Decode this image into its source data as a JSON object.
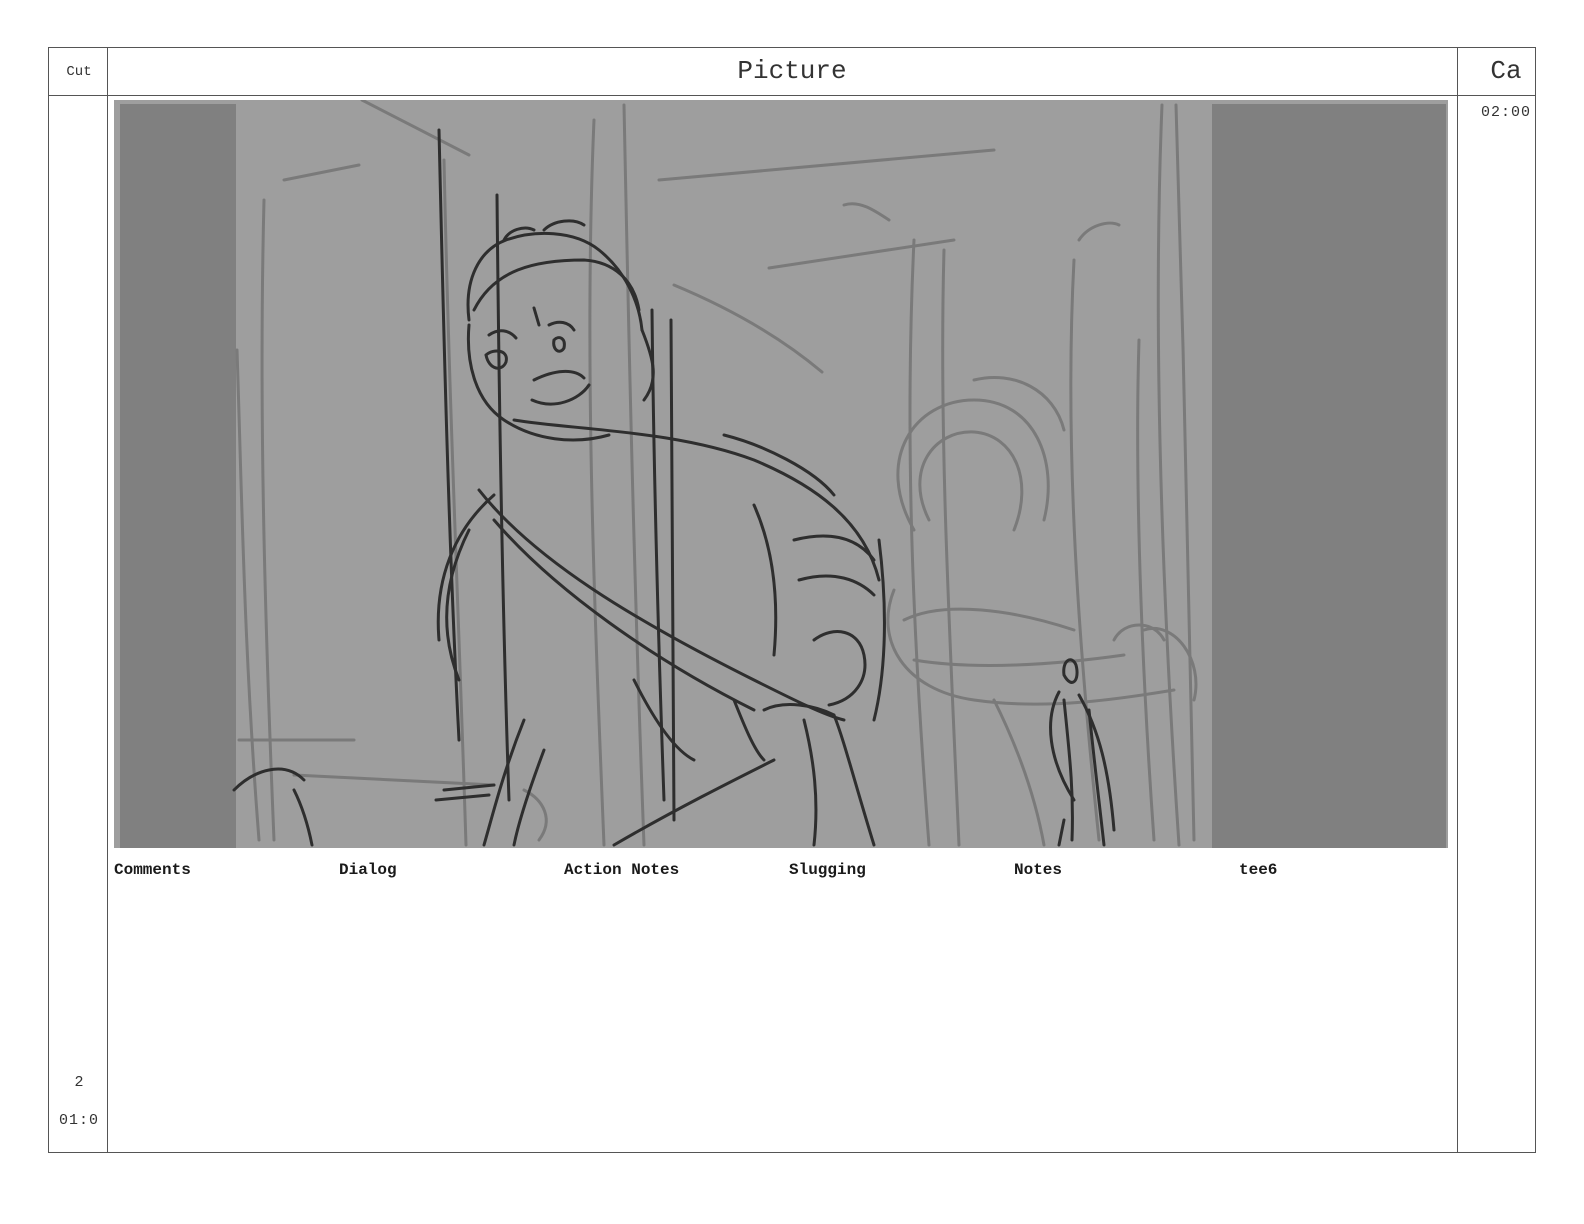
{
  "header": {
    "cut_label": "Cut",
    "picture_label": "Picture",
    "camera_label": "Ca"
  },
  "camera": {
    "time": "02:00"
  },
  "panel": {
    "number": "2",
    "time": "01:0"
  },
  "fields": [
    {
      "label": "Comments"
    },
    {
      "label": "Dialog"
    },
    {
      "label": "Action Notes"
    },
    {
      "label": "Slugging"
    },
    {
      "label": "Notes"
    },
    {
      "label": "tee6"
    }
  ],
  "colors": {
    "frame_bg": "#9e9e9e",
    "side_bar": "#808080",
    "sketch_dark": "#2e2e2e",
    "sketch_light": "#777777"
  }
}
